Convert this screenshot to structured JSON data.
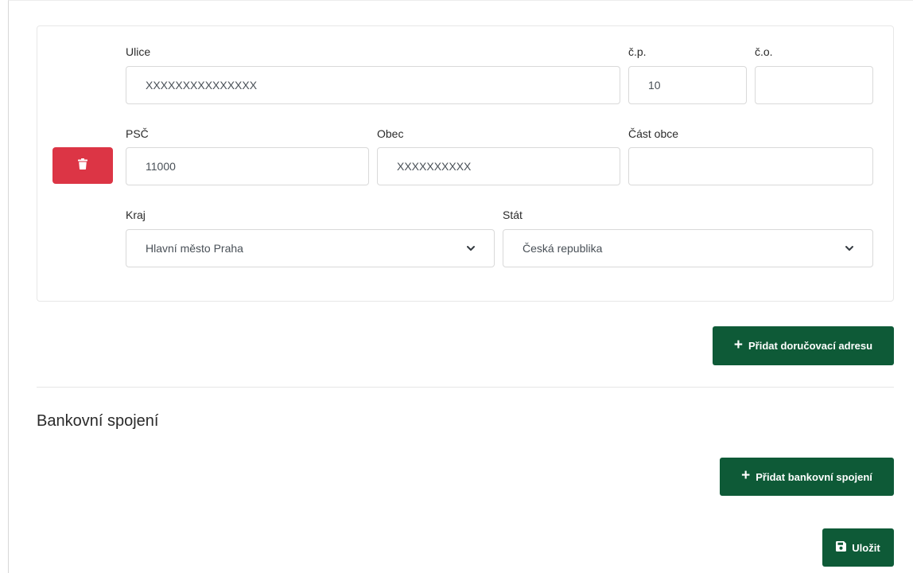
{
  "address": {
    "street": {
      "label": "Ulice",
      "value": "XXXXXXXXXXXXXXX"
    },
    "house_number": {
      "label": "č.p.",
      "value": "10"
    },
    "orientation_number": {
      "label": "č.o.",
      "value": ""
    },
    "postal_code": {
      "label": "PSČ",
      "value": "11000"
    },
    "municipality": {
      "label": "Obec",
      "value": "XXXXXXXXXX"
    },
    "municipality_part": {
      "label": "Část obce",
      "value": ""
    },
    "region": {
      "label": "Kraj",
      "value": "Hlavní město Praha"
    },
    "country": {
      "label": "Stát",
      "value": "Česká republika"
    }
  },
  "actions": {
    "add_delivery_address": "Přidat doručovací adresu",
    "add_bank_connection": "Přidat bankovní spojení",
    "save": "Uložit"
  },
  "bank_section": {
    "title": "Bankovní spojení"
  },
  "icons": {
    "delete": "trash-icon",
    "add": "plus-icon",
    "save": "floppy-disk-icon",
    "dropdown": "chevron-down-icon"
  },
  "colors": {
    "danger": "#dc3545",
    "primary_green": "#0e5a37"
  }
}
